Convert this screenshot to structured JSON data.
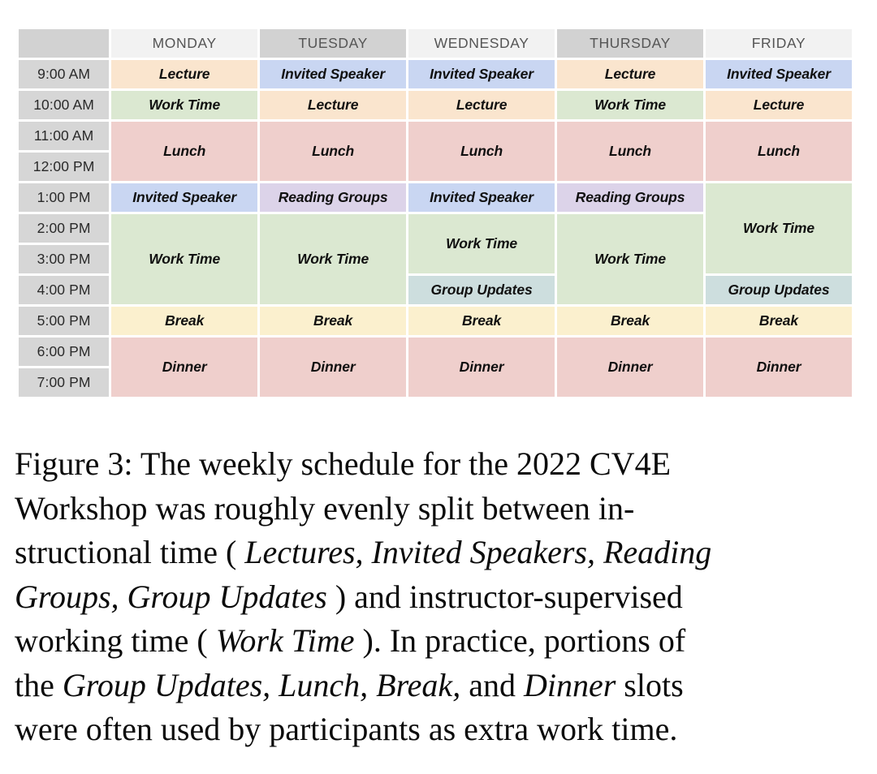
{
  "figure": {
    "label": "Figure 3:",
    "caption_full": "Figure 3: The weekly schedule for the 2022 CV4E Workshop was roughly evenly split between instructional time (Lectures, Invited Speakers, Reading Groups, Group Updates) and instructor-supervised working time (Work Time). In practice, portions of the Group Updates, Lunch, Break, and Dinner slots were often used by participants as extra work time."
  },
  "caption_lines": {
    "l1": [
      "Figure 3:",
      "The",
      "weekly",
      "schedule",
      "for",
      "the",
      "2022",
      "CV4E"
    ],
    "l2": [
      "Workshop",
      "was",
      "roughly",
      "evenly",
      "split",
      "between",
      "in-"
    ],
    "l3_a": "structional time (",
    "l3_b": "Lectures, Invited Speakers, Reading",
    "l4_a": "Groups,  Group  Updates",
    "l4_b": ") and instructor-supervised",
    "l5_a": "working time (",
    "l5_b": "Work Time",
    "l5_c": "). In practice, portions of",
    "l6_a": "the ",
    "l6_b": "Group Updates, Lunch, Break,",
    "l6_c": " and ",
    "l6_d": "Dinner",
    "l6_e": " slots",
    "l7": "were often used by participants as extra work time."
  },
  "legend_colors": {
    "lecture": "#FAE5CE",
    "invited_speaker": "#C9D6F2",
    "reading_groups": "#DCD3E9",
    "group_updates": "#CDDEDE",
    "work_time": "#DBE8D1",
    "lunch": "#EFCFCC",
    "dinner": "#EFCFCC",
    "break": "#FBF0CE",
    "header_light": "#F2F2F2",
    "header_dark": "#D2D2D2",
    "time_cell": "#D6D6D6",
    "corner": "#D2D2D2",
    "page_background": "#FFFFFF"
  },
  "schedule": {
    "days": [
      "MONDAY",
      "TUESDAY",
      "WEDNESDAY",
      "THURSDAY",
      "FRIDAY"
    ],
    "times": [
      "9:00 AM",
      "10:00 AM",
      "11:00 AM",
      "12:00 PM",
      "1:00 PM",
      "2:00 PM",
      "3:00 PM",
      "4:00 PM",
      "5:00 PM",
      "6:00 PM",
      "7:00 PM"
    ],
    "activity_labels": {
      "lecture": "Lecture",
      "invited_speaker": "Invited Speaker",
      "reading_groups": "Reading Groups",
      "group_updates": "Group Updates",
      "work_time": "Work Time",
      "lunch": "Lunch",
      "break": "Break",
      "dinner": "Dinner"
    },
    "rows": {
      "r0": {
        "monday": "Lecture",
        "tuesday": "Invited Speaker",
        "wednesday": "Invited Speaker",
        "thursday": "Lecture",
        "friday": "Invited Speaker"
      },
      "r1": {
        "monday": "Work Time",
        "tuesday": "Lecture",
        "wednesday": "Lecture",
        "thursday": "Work Time",
        "friday": "Lecture"
      },
      "r2": {
        "monday": "Lunch",
        "tuesday": "Lunch",
        "wednesday": "Lunch",
        "thursday": "Lunch",
        "friday": "Lunch"
      },
      "r4": {
        "monday": "Invited Speaker",
        "tuesday": "Reading Groups",
        "wednesday": "Invited Speaker",
        "thursday": "Reading Groups",
        "friday": "Work Time"
      },
      "r5": {
        "monday": "Work Time",
        "tuesday": "Work Time",
        "wednesday": "Work Time",
        "thursday": "Work Time"
      },
      "r7": {
        "wednesday": "Group Updates",
        "friday": "Group Updates"
      },
      "r8": {
        "monday": "Break",
        "tuesday": "Break",
        "wednesday": "Break",
        "thursday": "Break",
        "friday": "Break"
      },
      "r9": {
        "monday": "Dinner",
        "tuesday": "Dinner",
        "wednesday": "Dinner",
        "thursday": "Dinner",
        "friday": "Dinner"
      }
    }
  }
}
